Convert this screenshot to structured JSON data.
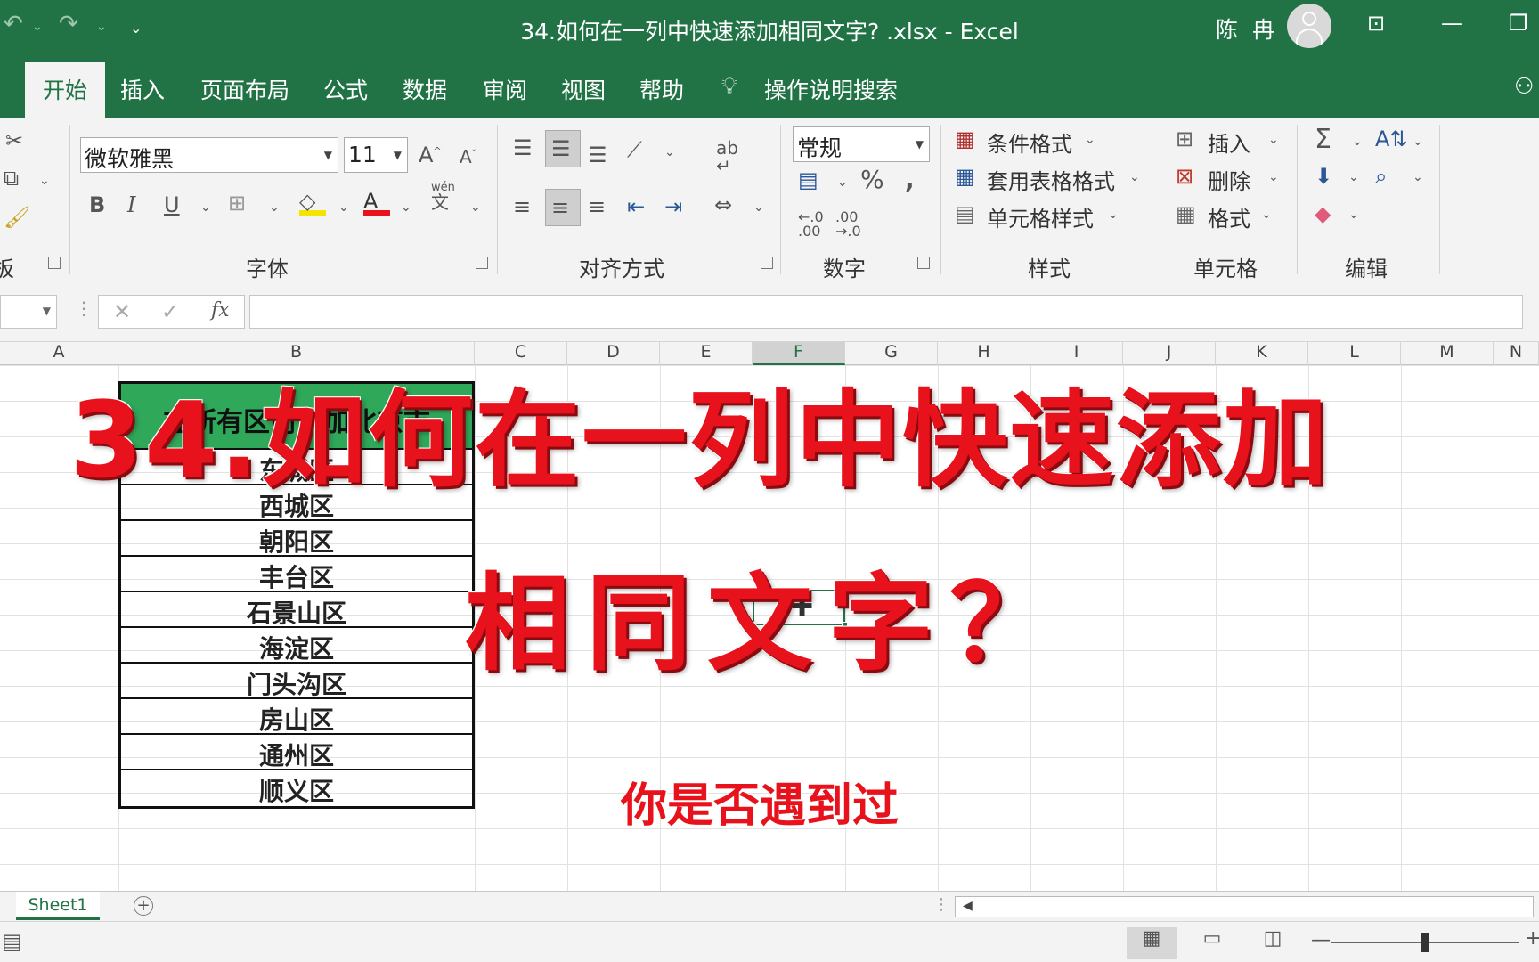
{
  "window": {
    "title": "34.如何在一列中快速添加相同文字? .xlsx  -  Excel",
    "user": "陈 冉"
  },
  "tabs": [
    "开始",
    "插入",
    "页面布局",
    "公式",
    "数据",
    "审阅",
    "视图",
    "帮助"
  ],
  "tell_me": "操作说明搜索",
  "ribbon": {
    "font_name": "微软雅黑",
    "font_size": "11",
    "number_format": "常规",
    "groups": {
      "clipboard": "板",
      "font": "字体",
      "alignment": "对齐方式",
      "number": "数字",
      "styles": "样式",
      "cells": "单元格",
      "editing": "编辑"
    },
    "styles_items": [
      "条件格式",
      "套用表格格式",
      "单元格样式"
    ],
    "cells_items": [
      "插入",
      "删除",
      "格式"
    ],
    "phonetic_label": "wén"
  },
  "formula_bar": {
    "fx": "fx",
    "value": ""
  },
  "columns": [
    "A",
    "B",
    "C",
    "D",
    "E",
    "F",
    "G",
    "H",
    "I",
    "J",
    "K",
    "L",
    "M",
    "N"
  ],
  "selected_column": "F",
  "table": {
    "header": "在所有区前添加北京市",
    "rows": [
      "东城区",
      "西城区",
      "朝阳区",
      "丰台区",
      "石景山区",
      "海淀区",
      "门头沟区",
      "房山区",
      "通州区",
      "顺义区"
    ]
  },
  "overlay": {
    "line1": "34.如何在一列中快速添加",
    "line2": "相同文字？",
    "subtitle": "你是否遇到过"
  },
  "sheets": [
    "Sheet1"
  ],
  "colors": {
    "excel_green": "#217346",
    "header_fill": "#2fa85a",
    "overlay_red": "#e8121c"
  }
}
